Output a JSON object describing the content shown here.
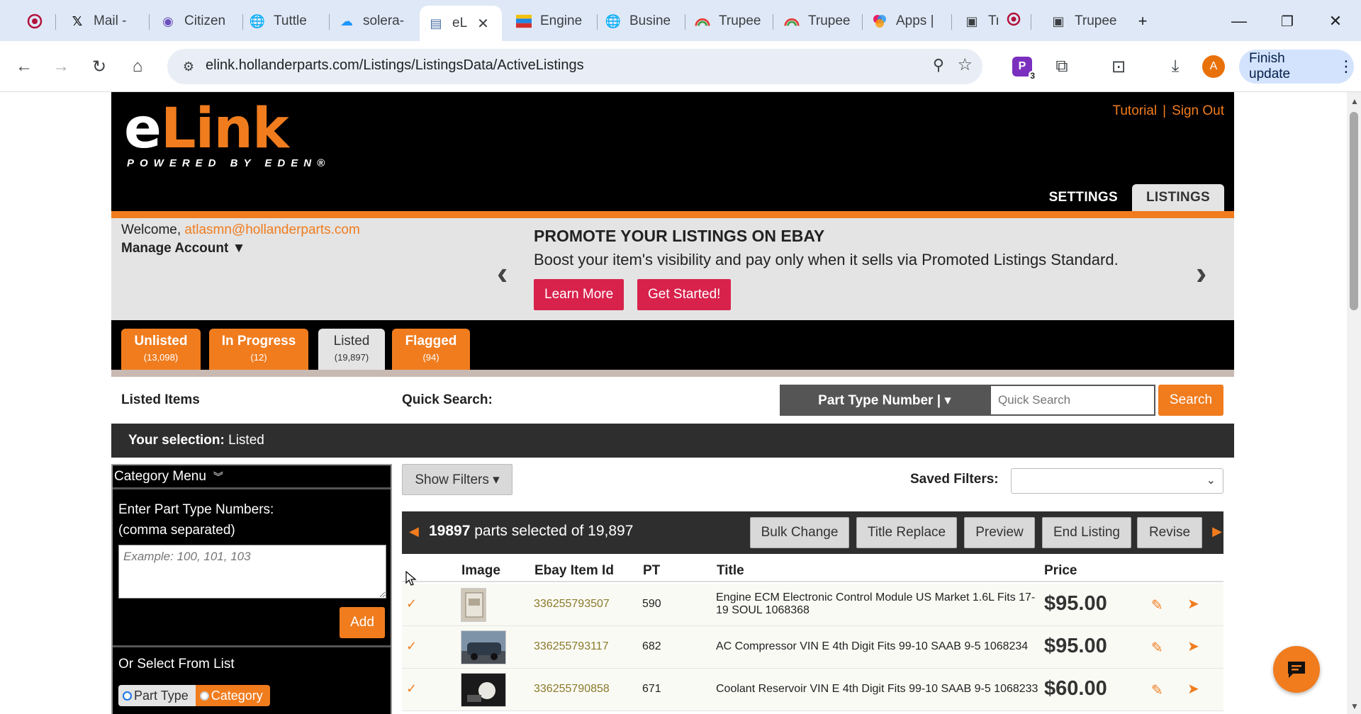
{
  "browser": {
    "tabs": [
      {
        "title": "",
        "icon": "record-icon"
      },
      {
        "title": "Mail - ",
        "icon": "x-logo-icon"
      },
      {
        "title": "Citizen",
        "icon": "eye-icon"
      },
      {
        "title": "Tuttle",
        "icon": "globe-icon"
      },
      {
        "title": "solera-",
        "icon": "cloud-icon"
      },
      {
        "title": "eL",
        "icon": "document-icon",
        "active": true
      },
      {
        "title": "Engine",
        "icon": "flag-icon"
      },
      {
        "title": "Busine",
        "icon": "globe-icon"
      },
      {
        "title": "Trupee",
        "icon": "rainbow-icon"
      },
      {
        "title": "Trupee",
        "icon": "rainbow-icon"
      },
      {
        "title": "Apps |",
        "icon": "apps-icon"
      },
      {
        "title": "Tru",
        "icon": "square-icon"
      },
      {
        "title": "Trupee",
        "icon": "square-icon"
      }
    ],
    "url": "elink.hollanderparts.com/Listings/ListingsData/ActiveListings",
    "finish_update": "Finish update",
    "profile_initial": "A",
    "extension_badge": "3"
  },
  "header": {
    "logo_e": "e",
    "logo_link": "Link",
    "logo_powered": "POWERED BY EDEN®",
    "tutorial": "Tutorial",
    "sign_out": "Sign Out",
    "nav_settings": "SETTINGS",
    "nav_listings": "LISTINGS"
  },
  "promo": {
    "welcome_prefix": "Welcome, ",
    "email": "atlasmn@hollanderparts.com",
    "manage_account": "Manage Account ▼",
    "title": "PROMOTE YOUR LISTINGS ON EBAY",
    "subtitle": "Boost your item's visibility and pay only when it sells via Promoted Listings Standard.",
    "learn_more": "Learn More",
    "get_started": "Get Started!"
  },
  "status_tabs": [
    {
      "label": "Unlisted",
      "count": "(13,098)"
    },
    {
      "label": "In Progress",
      "count": "(12)"
    },
    {
      "label": "Listed",
      "count": "(19,897)"
    },
    {
      "label": "Flagged",
      "count": "(94)"
    }
  ],
  "search": {
    "listed_items": "Listed Items",
    "quick_search_label": "Quick Search:",
    "part_type_select": "Part Type Number | ▾",
    "placeholder": "Quick Search",
    "button": "Search"
  },
  "selection": {
    "prefix": "Your selection:",
    "value": " Listed"
  },
  "sidebar": {
    "category_menu": "Category Menu",
    "enter_label_1": "Enter Part Type Numbers:",
    "enter_label_2": "(comma separated)",
    "input_placeholder": "Example: 100, 101, 103",
    "add": "Add",
    "or_select": "Or Select From List",
    "radio_part_type": "Part Type",
    "radio_category": "Category"
  },
  "filters": {
    "show_filters": "Show Filters ▾",
    "saved_filters": "Saved Filters:"
  },
  "actions": {
    "selected_count": "19897",
    "selected_text": " parts selected of 19,897",
    "bulk_change": "Bulk Change",
    "title_replace": "Title Replace",
    "preview": "Preview",
    "end_listing": "End Listing",
    "revise": "Revise"
  },
  "table": {
    "columns": {
      "image": "Image",
      "ebay_item_id": "Ebay Item Id",
      "pt": "PT",
      "title": "Title",
      "price": "Price"
    },
    "rows": [
      {
        "checked": "✓",
        "ebay_id": "336255793507",
        "pt": "590",
        "title": "Engine ECM Electronic Control Module US Market 1.6L Fits 17-19 SOUL 1068368",
        "price": "$95.00"
      },
      {
        "checked": "✓",
        "ebay_id": "336255793117",
        "pt": "682",
        "title": "AC Compressor VIN E 4th Digit Fits 99-10 SAAB 9-5 1068234",
        "price": "$95.00"
      },
      {
        "checked": "✓",
        "ebay_id": "336255790858",
        "pt": "671",
        "title": "Coolant Reservoir VIN E 4th Digit Fits 99-10 SAAB 9-5 1068233",
        "price": "$60.00"
      }
    ]
  },
  "colors": {
    "accent_orange": "#f07c1e",
    "promo_red": "#d8224c",
    "header_black": "#000000"
  }
}
